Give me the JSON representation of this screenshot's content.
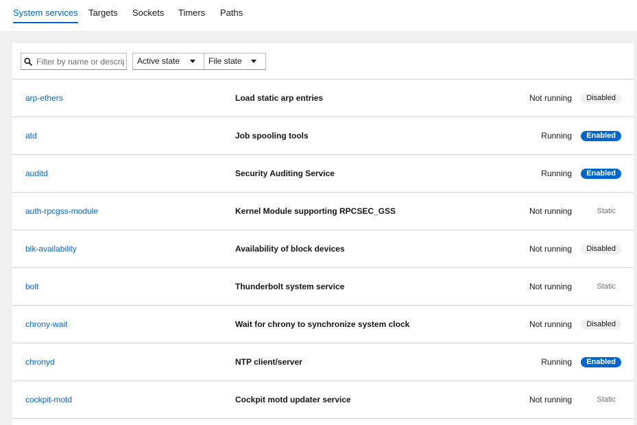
{
  "tabs": [
    {
      "label": "System services",
      "active": true
    },
    {
      "label": "Targets",
      "active": false
    },
    {
      "label": "Sockets",
      "active": false
    },
    {
      "label": "Timers",
      "active": false
    },
    {
      "label": "Paths",
      "active": false
    }
  ],
  "toolbar": {
    "search_placeholder": "Filter by name or description",
    "active_state_label": "Active state",
    "file_state_label": "File state"
  },
  "services": [
    {
      "name": "arp-ethers",
      "description": "Load static arp entries",
      "state": "Not running",
      "file_state": "Disabled"
    },
    {
      "name": "atd",
      "description": "Job spooling tools",
      "state": "Running",
      "file_state": "Enabled"
    },
    {
      "name": "auditd",
      "description": "Security Auditing Service",
      "state": "Running",
      "file_state": "Enabled"
    },
    {
      "name": "auth-rpcgss-module",
      "description": "Kernel Module supporting RPCSEC_GSS",
      "state": "Not running",
      "file_state": "Static"
    },
    {
      "name": "blk-availability",
      "description": "Availability of block devices",
      "state": "Not running",
      "file_state": "Disabled"
    },
    {
      "name": "bolt",
      "description": "Thunderbolt system service",
      "state": "Not running",
      "file_state": "Static"
    },
    {
      "name": "chrony-wait",
      "description": "Wait for chrony to synchronize system clock",
      "state": "Not running",
      "file_state": "Disabled"
    },
    {
      "name": "chronyd",
      "description": "NTP client/server",
      "state": "Running",
      "file_state": "Enabled"
    },
    {
      "name": "cockpit-motd",
      "description": "Cockpit motd updater service",
      "state": "Not running",
      "file_state": "Static"
    }
  ],
  "colors": {
    "accent": "#0066cc",
    "border": "#d2d2d2",
    "page_bg": "#f0f0f0"
  }
}
